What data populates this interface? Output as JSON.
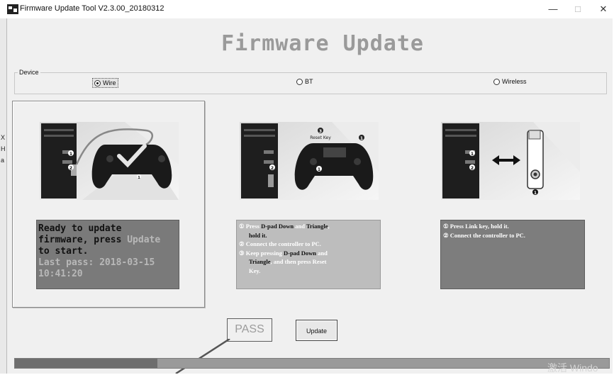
{
  "window": {
    "title": "Firmware Update Tool V2.3.00_20180312",
    "controls": {
      "minimize": "—",
      "maximize": "□",
      "close": "✕"
    }
  },
  "left_sliver_glyphs": [
    "X",
    "H",
    "a"
  ],
  "heading": "Firmware Update",
  "device": {
    "label": "Device",
    "options": [
      {
        "label": "Wire",
        "selected": true
      },
      {
        "label": "BT",
        "selected": false
      },
      {
        "label": "Wireless",
        "selected": false
      }
    ]
  },
  "panels": {
    "wire": {
      "illustration_labels": {
        "usb_port_1": "1",
        "usb_port_2": "2",
        "controller_marker": "1"
      },
      "status": {
        "line1": "Ready to update",
        "line2a": "firmware, press ",
        "line2b": "Update",
        "line3": "to start.",
        "line4": "Last pass: 2018-03-15",
        "line5": "10:41:20"
      }
    },
    "bt": {
      "illustration_labels": {
        "reset_key": "Reset Key",
        "step3": "3",
        "step1": "1",
        "controller_marker": "1",
        "usb_port_2": "2"
      },
      "steps": [
        {
          "num": "①",
          "parts": [
            {
              "t": "Press ",
              "k": false
            },
            {
              "t": "D-pad Down",
              "k": true
            },
            {
              "t": " and ",
              "k": false
            },
            {
              "t": "Triangle",
              "k": true
            },
            {
              "t": ",",
              "k": false
            }
          ]
        },
        {
          "num": "",
          "parts": [
            {
              "t": "hold it.",
              "k": true
            }
          ]
        },
        {
          "num": "②",
          "parts": [
            {
              "t": "Connect the controller to PC.",
              "k": false
            }
          ]
        },
        {
          "num": "③",
          "parts": [
            {
              "t": "Keep pressing ",
              "k": false
            },
            {
              "t": "D-pad Down",
              "k": true
            },
            {
              "t": " and",
              "k": false
            }
          ]
        },
        {
          "num": "",
          "parts": [
            {
              "t": "Triangle",
              "k": true
            },
            {
              "t": ", and then press ",
              "k": false
            },
            {
              "t": "Reset",
              "k": false
            }
          ]
        },
        {
          "num": "",
          "parts": [
            {
              "t": "Key.",
              "k": false
            }
          ]
        }
      ]
    },
    "wireless": {
      "illustration_labels": {
        "usb_port_1": "1",
        "usb_port_2": "2",
        "dongle_marker": "1"
      },
      "steps": [
        {
          "num": "①",
          "text": "Press Link key, hold it."
        },
        {
          "num": "②",
          "text": "Connect the controller to PC."
        }
      ]
    }
  },
  "result": "PASS",
  "update_button": "Update",
  "progress": {
    "fraction": 0.24,
    "fill_color": "#6e6e6e",
    "track_color": "#9a9a9a"
  },
  "watermark": "激活 Windo",
  "colors": {
    "heading": "#9a9a9a",
    "wire_box": "#7a7a7a",
    "bt_box": "#bdbdbd",
    "wireless_box": "#7d7d7d"
  }
}
